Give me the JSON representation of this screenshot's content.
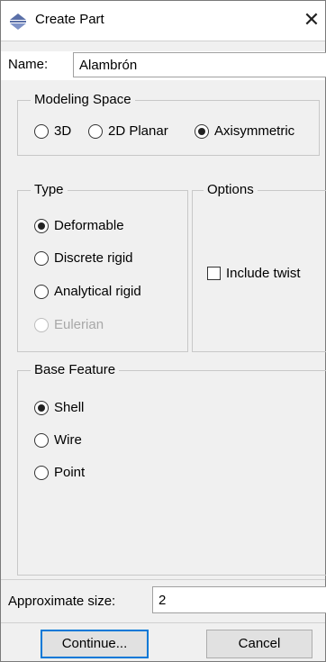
{
  "dialog": {
    "title": "Create Part"
  },
  "name": {
    "label": "Name:",
    "value": "Alambrón"
  },
  "modeling_space": {
    "legend": "Modeling Space",
    "options": [
      "3D",
      "2D Planar",
      "Axisymmetric"
    ],
    "selected": "Axisymmetric"
  },
  "type": {
    "legend": "Type",
    "options": [
      "Deformable",
      "Discrete rigid",
      "Analytical rigid",
      "Eulerian"
    ],
    "selected": "Deformable",
    "disabled": [
      "Eulerian"
    ]
  },
  "options": {
    "legend": "Options",
    "include_twist_label": "Include twist",
    "include_twist_checked": false
  },
  "base_feature": {
    "legend": "Base Feature",
    "options": [
      "Shell",
      "Wire",
      "Point"
    ],
    "selected": "Shell"
  },
  "approx_size": {
    "label": "Approximate size:",
    "value": "2"
  },
  "buttons": {
    "continue": "Continue...",
    "cancel": "Cancel"
  },
  "icons": {
    "app": "abaqus-part-icon",
    "close": "close-icon"
  }
}
